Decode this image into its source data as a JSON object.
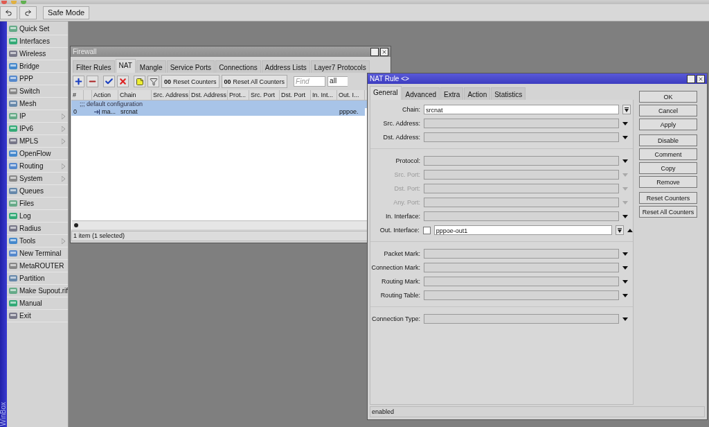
{
  "toolbar": {
    "safe_mode": "Safe Mode"
  },
  "sidebar": {
    "brand": "WinBox",
    "items": [
      {
        "label": "Quick Set",
        "submenu": false
      },
      {
        "label": "Interfaces",
        "submenu": false
      },
      {
        "label": "Wireless",
        "submenu": false
      },
      {
        "label": "Bridge",
        "submenu": false
      },
      {
        "label": "PPP",
        "submenu": false
      },
      {
        "label": "Switch",
        "submenu": false
      },
      {
        "label": "Mesh",
        "submenu": false
      },
      {
        "label": "IP",
        "submenu": true
      },
      {
        "label": "IPv6",
        "submenu": true
      },
      {
        "label": "MPLS",
        "submenu": true
      },
      {
        "label": "OpenFlow",
        "submenu": false
      },
      {
        "label": "Routing",
        "submenu": true
      },
      {
        "label": "System",
        "submenu": true
      },
      {
        "label": "Queues",
        "submenu": false
      },
      {
        "label": "Files",
        "submenu": false
      },
      {
        "label": "Log",
        "submenu": false
      },
      {
        "label": "Radius",
        "submenu": false
      },
      {
        "label": "Tools",
        "submenu": true
      },
      {
        "label": "New Terminal",
        "submenu": false
      },
      {
        "label": "MetaROUTER",
        "submenu": false
      },
      {
        "label": "Partition",
        "submenu": false
      },
      {
        "label": "Make Supout.rif",
        "submenu": false
      },
      {
        "label": "Manual",
        "submenu": false
      },
      {
        "label": "Exit",
        "submenu": false
      }
    ]
  },
  "firewall": {
    "title": "Firewall",
    "tabs": [
      {
        "label": "Filter Rules",
        "selected": false
      },
      {
        "label": "NAT",
        "selected": true
      },
      {
        "label": "Mangle",
        "selected": false
      },
      {
        "label": "Service Ports",
        "selected": false
      },
      {
        "label": "Connections",
        "selected": false
      },
      {
        "label": "Address Lists",
        "selected": false
      },
      {
        "label": "Layer7 Protocols",
        "selected": false
      }
    ],
    "counter_buttons": [
      {
        "glyph": "00",
        "label": "Reset Counters"
      },
      {
        "glyph": "00",
        "label": "Reset All Counters"
      }
    ],
    "find": {
      "placeholder": "Find"
    },
    "filter": {
      "value": "all"
    },
    "columns": [
      "#",
      "Action",
      "Chain",
      "Src. Address",
      "Dst. Address",
      "Prot...",
      "Src. Port",
      "Dst. Port",
      "In. Int...",
      "Out. I..."
    ],
    "rows": [
      {
        "kind": "comment",
        "text": ";;; default configuration",
        "selected": true
      },
      {
        "kind": "rule",
        "selected": true,
        "cells": [
          "0",
          "ma...",
          "srcnat",
          null,
          null,
          null,
          null,
          null,
          null,
          "pppoe."
        ]
      }
    ],
    "status": "1 item (1 selected)"
  },
  "nat_rule": {
    "title": "NAT Rule <>",
    "tabs": [
      {
        "label": "General",
        "selected": true
      },
      {
        "label": "Advanced",
        "selected": false
      },
      {
        "label": "Extra",
        "selected": false
      },
      {
        "label": "Action",
        "selected": false
      },
      {
        "label": "Statistics",
        "selected": false
      }
    ],
    "field_groups": [
      [
        {
          "label": "Chain:",
          "kind": "combo",
          "value": "srcnat",
          "disabled": false
        },
        {
          "label": "Src. Address:",
          "kind": "select",
          "disabled": false
        },
        {
          "label": "Dst. Address:",
          "kind": "select",
          "disabled": false
        }
      ],
      [
        {
          "label": "Protocol:",
          "kind": "select",
          "disabled": false
        },
        {
          "label": "Src. Port:",
          "kind": "select",
          "disabled": true
        },
        {
          "label": "Dst. Port:",
          "kind": "select",
          "disabled": true
        },
        {
          "label": "Any. Port:",
          "kind": "select",
          "disabled": true
        },
        {
          "label": "In. Interface:",
          "kind": "select",
          "disabled": false
        },
        {
          "label": "Out. Interface:",
          "kind": "negatable",
          "value": "pppoe-out1",
          "negated": false,
          "disabled": false
        }
      ],
      [
        {
          "label": "Packet Mark:",
          "kind": "select",
          "disabled": false
        },
        {
          "label": "Connection Mark:",
          "kind": "select",
          "disabled": false
        },
        {
          "label": "Routing Mark:",
          "kind": "select",
          "disabled": false
        },
        {
          "label": "Routing Table:",
          "kind": "select",
          "disabled": false
        }
      ],
      [
        {
          "label": "Connection Type:",
          "kind": "select",
          "disabled": false
        }
      ]
    ],
    "button_groups": [
      [
        "OK",
        "Cancel",
        "Apply"
      ],
      [
        "Disable",
        "Comment",
        "Copy",
        "Remove"
      ],
      [
        "Reset Counters",
        "Reset All Counters"
      ]
    ],
    "status": "enabled"
  }
}
